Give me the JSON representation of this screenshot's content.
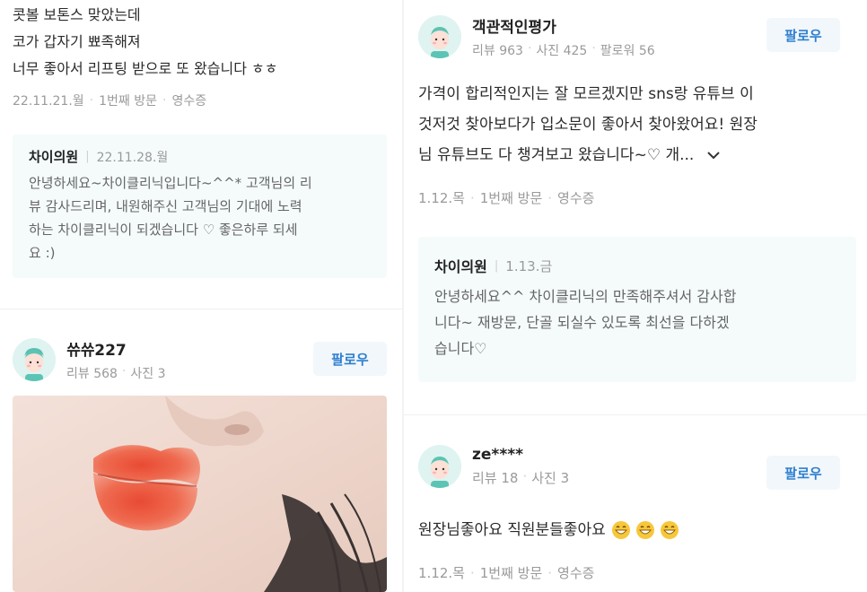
{
  "left": {
    "review1": {
      "lines": [
        "콧볼 보톤스 맞았는데",
        "코가 갑자기 뾰족해져",
        "너무 좋아서 리프팅 받으로 또 왔습니다 ㅎㅎ"
      ],
      "date": "22.11.21.월",
      "visit": "1번째 방문",
      "receipt": "영수증"
    },
    "reply1": {
      "owner": "차이의원",
      "date": "22.11.28.월",
      "lines": [
        "안녕하세요~차이클리닉입니다~^^* 고객님의 리",
        "뷰 감사드리며, 내원해주신 고객님의 기대에 노력",
        "하는 차이클리닉이 되겠습니다 ♡ 좋은하루 되세",
        "요 :)"
      ]
    },
    "user2": {
      "name": "쓔쓔227",
      "stats": [
        "리뷰 568",
        "사진 3"
      ],
      "follow": "팔로우"
    }
  },
  "right": {
    "user1": {
      "name": "객관적인평가",
      "stats": [
        "리뷰 963",
        "사진 425",
        "팔로워 56"
      ],
      "follow": "팔로우"
    },
    "review1": {
      "lines": [
        "가격이 합리적인지는 잘 모르겠지만 sns랑 유튜브 이",
        "것저것 찾아보다가 입소문이 좋아서 찾아왔어요! 원장",
        "님 유튜브도 다 챙겨보고 왔습니다~♡ 개..."
      ],
      "date": "1.12.목",
      "visit": "1번째 방문",
      "receipt": "영수증"
    },
    "reply1": {
      "owner": "차이의원",
      "date": "1.13.금",
      "lines": [
        "안녕하세요^^ 차이클리닉의 만족해주셔서 감사합",
        "니다~ 재방문, 단골 되실수 있도록 최선을 다하겠",
        "습니다♡"
      ]
    },
    "user2": {
      "name": "ze****",
      "stats": [
        "리뷰 18",
        "사진 3"
      ],
      "follow": "팔로우"
    },
    "review2": {
      "text": "원장님좋아요 직원분들좋아요",
      "date": "1.12.목",
      "visit": "1번째 방문",
      "receipt": "영수증"
    }
  },
  "colors": {
    "follow_text": "#2e7fd0",
    "follow_bg": "#f2f7fb",
    "reply_bg": "#f5fbfb",
    "avatar_bg": "#dff3f0"
  },
  "icons": [
    "expand-chevron-icon",
    "grinning-emoji-icon",
    "avatar-icon"
  ]
}
